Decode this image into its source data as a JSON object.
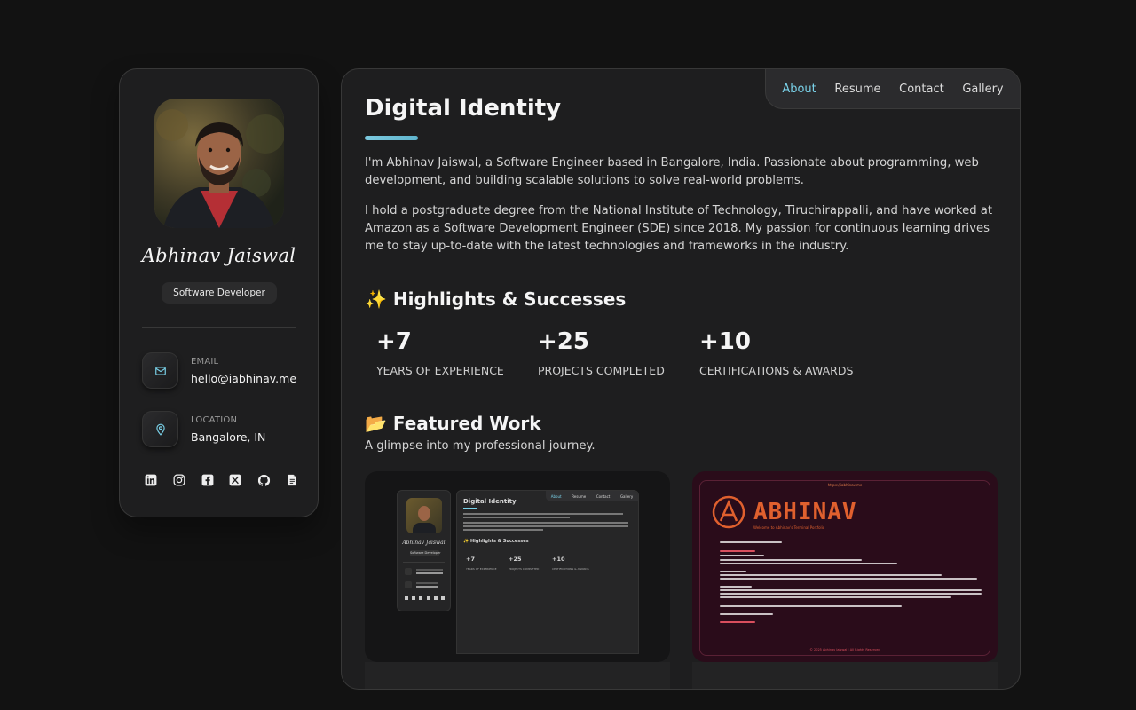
{
  "profile": {
    "name": "Abhinav Jaiswal",
    "role": "Software Developer",
    "email_label": "EMAIL",
    "email": "hello@iabhinav.me",
    "location_label": "LOCATION",
    "location": "Bangalore, IN",
    "socials": [
      "linkedin-icon",
      "instagram-icon",
      "facebook-icon",
      "x-icon",
      "github-icon",
      "document-icon"
    ]
  },
  "nav": {
    "items": [
      "About",
      "Resume",
      "Contact",
      "Gallery"
    ],
    "active": "About"
  },
  "about": {
    "title": "Digital Identity",
    "p1": "I'm Abhinav Jaiswal, a Software Engineer based in Bangalore, India. Passionate about programming, web development, and building scalable solutions to solve real-world problems.",
    "p2": "I hold a postgraduate degree from the National Institute of Technology, Tiruchirappalli, and have worked at Amazon as a Software Development Engineer (SDE) since 2018. My passion for continuous learning drives me to stay up-to-date with the latest technologies and frameworks in the industry."
  },
  "highlights": {
    "title": "✨ Highlights & Successes",
    "stats": [
      {
        "value": "+7",
        "label": "YEARS OF EXPERIENCE"
      },
      {
        "value": "+25",
        "label": "PROJECTS COMPLETED"
      },
      {
        "value": "+10",
        "label": "CERTIFICATIONS & AWARDS"
      }
    ]
  },
  "featured": {
    "title": "📂 Featured Work",
    "subtitle": "A glimpse into my professional journey.",
    "cards": [
      {
        "mini_name": "Abhinav Jaiswal",
        "mini_role": "Software Developer",
        "mini_title": "Digital Identity",
        "mini_nav": [
          "About",
          "Resume",
          "Contact",
          "Gallery"
        ],
        "mini_highlights": "✨ Highlights & Successes",
        "mini_stats": [
          "+7",
          "+25",
          "+10"
        ],
        "mini_labels": [
          "YEARS OF EXPERIENCE",
          "PROJECTS COMPLETED",
          "CERTIFICATIONS & AWARDS"
        ]
      },
      {
        "url": "https://iabhinav.me",
        "brand": "ABHINAV",
        "tagline": "Welcome to Abhinav's Terminal Portfolio",
        "footer": "© 2025 Abhinav Jaiswal | All Rights Reserved"
      }
    ]
  },
  "colors": {
    "accent": "#7ad3ea",
    "background": "#121212",
    "panel": "#1e1e1f",
    "terminal_bg": "#2a0c1a",
    "terminal_accent": "#e0602e"
  }
}
